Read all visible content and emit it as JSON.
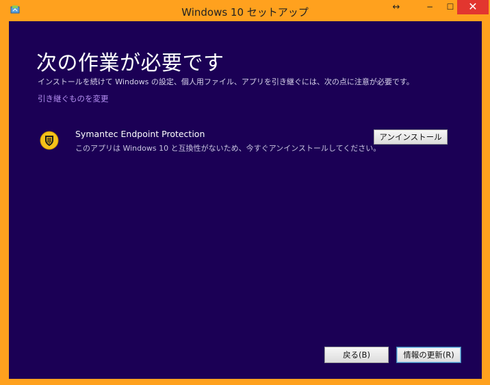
{
  "window": {
    "title": "Windows 10 セットアップ",
    "resize_glyph": "↔",
    "minimize_glyph": "−",
    "maximize_glyph": "☐",
    "close_glyph": "✕"
  },
  "heading": "次の作業が必要です",
  "subtitle": "インストールを続けて Windows の設定、個人用ファイル、アプリを引き継ぐには、次の点に注意が必要です。",
  "change_link": "引き継ぐものを変更",
  "item": {
    "icon": "symantec-shield-icon",
    "name": "Symantec Endpoint Protection",
    "description": "このアプリは Windows 10 と互換性がないため、今すぐアンインストールしてください。",
    "button": "アンインストール"
  },
  "footer": {
    "back_button": "戻る(B)",
    "refresh_button": "情報の更新(R)"
  },
  "colors": {
    "frame": "#ffa11e",
    "content_bg": "#1b0055",
    "link": "#b38ef0",
    "close_button": "#e2362f"
  }
}
